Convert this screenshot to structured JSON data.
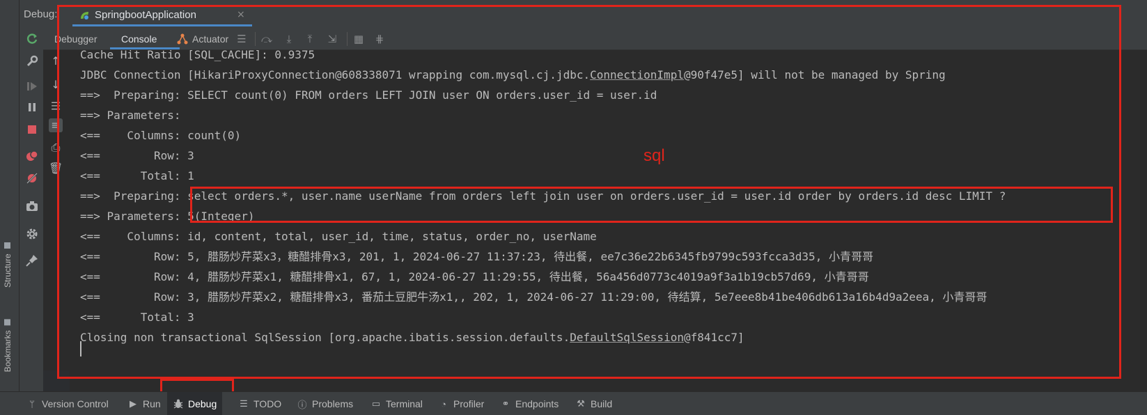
{
  "window": {
    "debug_label": "Debug:",
    "run_tab": {
      "label": "SpringbootApplication",
      "close": "×"
    }
  },
  "toolbar": {
    "tabs": [
      {
        "label": "Debugger"
      },
      {
        "label": "Console",
        "selected": true
      },
      {
        "label": "Actuator"
      }
    ]
  },
  "stripe": {
    "structure": "Structure",
    "bookmarks": "Bookmarks"
  },
  "console": {
    "lines": [
      "Cache Hit Ratio [SQL_CACHE]: 0.9375",
      "JDBC Connection [HikariProxyConnection@608338071 wrapping com.mysql.cj.jdbc.",
      "ConnectionImpl",
      "@90f47e5] will not be managed by Spring",
      "==>  Preparing: SELECT count(0) FROM orders LEFT JOIN user ON orders.user_id = user.id",
      "==> Parameters: ",
      "<==    Columns: count(0)",
      "<==        Row: 3",
      "<==      Total: 1",
      "==>  Preparing: select orders.*, user.name userName from orders left join user on orders.user_id = user.id order by orders.id desc LIMIT ?",
      "==> Parameters: 5(Integer)",
      "<==    Columns: id, content, total, user_id, time, status, order_no, userName",
      "<==        Row: 5, 腊肠炒芹菜x3，糖醋排骨x3, 201, 1, 2024-06-27 11:37:23, 待出餐, ee7c36e22b6345fb9799c593fcca3d35, 小青哥哥",
      "<==        Row: 4, 腊肠炒芹菜x1, 糖醋排骨x1, 67, 1, 2024-06-27 11:29:55, 待出餐, 56a456d0773c4019a9f3a1b19cb57d69, 小青哥哥",
      "<==        Row: 3, 腊肠炒芹菜x2, 糖醋排骨x3, 番茄土豆肥牛汤x1,, 202, 1, 2024-06-27 11:29:00, 待结算, 5e7eee8b41be406db613a16b4d9a2eea, 小青哥哥",
      "<==      Total: 3",
      "Closing non transactional SqlSession [org.apache.ibatis.session.defaults.",
      "DefaultSqlSession",
      "@f841cc7]"
    ]
  },
  "annotation": {
    "sql_label": "sql",
    "color": "#e0241b"
  },
  "bottom_bar": {
    "items": [
      {
        "label": "Version Control"
      },
      {
        "label": "Run"
      },
      {
        "label": "Debug",
        "active": true
      },
      {
        "label": "TODO"
      },
      {
        "label": "Problems"
      },
      {
        "label": "Terminal"
      },
      {
        "label": "Profiler"
      },
      {
        "label": "Endpoints"
      },
      {
        "label": "Build"
      }
    ]
  },
  "icons": {
    "rerun": "rerun-icon",
    "settings": "wrench-icon",
    "resume": "resume-icon",
    "pause": "pause-icon",
    "stop": "stop-icon",
    "breakpoints": "view-breakpoints-icon",
    "mute": "mute-breakpoints-icon",
    "camera": "camera-icon",
    "gear": "gear-icon",
    "pin": "pin-icon"
  }
}
